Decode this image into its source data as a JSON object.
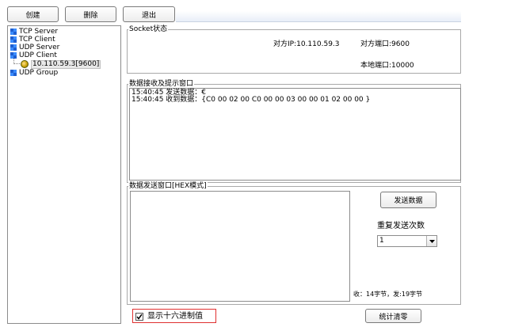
{
  "toolbar": {
    "create": "创建",
    "delete": "删除",
    "exit": "退出"
  },
  "tree": {
    "items": [
      {
        "label": "TCP Server"
      },
      {
        "label": "TCP Client"
      },
      {
        "label": "UDP Server"
      },
      {
        "label": "UDP Client"
      },
      {
        "label": "10.110.59.3[9600]"
      },
      {
        "label": "UDP Group"
      }
    ]
  },
  "socket": {
    "title": "Socket状态",
    "peer_ip": "对方IP:10.110.59.3",
    "peer_port": "对方端口:9600",
    "local_port": "本地端口:10000"
  },
  "receive": {
    "title": "数据接收及提示窗口",
    "lines": [
      "15:40:45 发送数据：€",
      "15:40:45 收到数据：{C0 00 02 00 C0 00 00 03 00 00 01 02 00 00 }"
    ]
  },
  "send": {
    "title": "数据发送窗口[HEX模式]",
    "send_button": "发送数据",
    "repeat_label": "重复发送次数",
    "repeat_value": "1",
    "stats": "收：14字节，发:19字节",
    "hex_label": "显示十六进制值",
    "clear_button": "统计清零"
  },
  "colors": {
    "highlight_border": "#e03030",
    "tree_icon_blue": "#1f5fd0",
    "tree_icon_green": "#2aa02a"
  }
}
